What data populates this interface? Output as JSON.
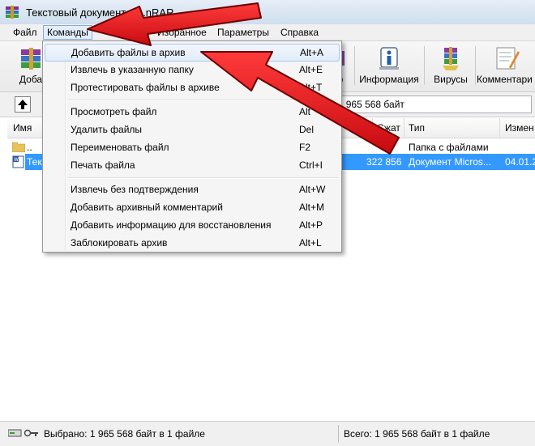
{
  "window": {
    "title": "Текстовый документ.ra...nRAR"
  },
  "menubar": {
    "items": [
      "Файл",
      "Команды",
      "Избранное",
      "Параметры",
      "Справка"
    ]
  },
  "toolbar": {
    "buttons": [
      {
        "label": "Доба",
        "icon": "add-archive-icon"
      },
      {
        "label": "Информация",
        "icon": "info-icon"
      },
      {
        "label": "Вирусы",
        "icon": "virus-scan-icon"
      },
      {
        "label": "Комментари",
        "icon": "comment-icon"
      }
    ],
    "partial_label": "р"
  },
  "addressbar": {
    "text": "в 1 965 568 байт"
  },
  "filelist": {
    "columns": [
      "Имя",
      "Сжат",
      "Тип",
      "Измен"
    ],
    "rows": [
      {
        "name": "..",
        "packed": "",
        "type": "Папка с файлами",
        "modified": "",
        "icon": "folder-icon"
      },
      {
        "name": "Текс",
        "packed": "322 856",
        "type": "Документ Micros...",
        "modified": "04.01.2",
        "icon": "word-document-icon"
      }
    ]
  },
  "commands_menu": {
    "items": [
      {
        "label": "Добавить файлы в архив",
        "shortcut": "Alt+A",
        "highlighted": true
      },
      {
        "label": "Извлечь в указанную папку",
        "shortcut": "Alt+E"
      },
      {
        "label": "Протестировать файлы в архиве",
        "shortcut": "Alt+T"
      },
      {
        "separator": true
      },
      {
        "label": "Просмотреть файл",
        "shortcut": "Alt"
      },
      {
        "label": "Удалить файлы",
        "shortcut": "Del"
      },
      {
        "label": "Переименовать файл",
        "shortcut": "F2"
      },
      {
        "label": "Печать файла",
        "shortcut": "Ctrl+I"
      },
      {
        "separator": true
      },
      {
        "label": "Извлечь без подтверждения",
        "shortcut": "Alt+W"
      },
      {
        "label": "Добавить архивный комментарий",
        "shortcut": "Alt+M"
      },
      {
        "label": "Добавить информацию для восстановления",
        "shortcut": "Alt+P"
      },
      {
        "label": "Заблокировать архив",
        "shortcut": "Alt+L"
      }
    ]
  },
  "statusbar": {
    "selected": "Выбрано: 1 965 568 байт в 1 файле",
    "total": "Всего: 1 965 568 байт в 1 файле"
  },
  "colors": {
    "accent_arrow": "#e8131a",
    "selection": "#3399ff",
    "menu_highlight_border": "#a8c7ef"
  }
}
